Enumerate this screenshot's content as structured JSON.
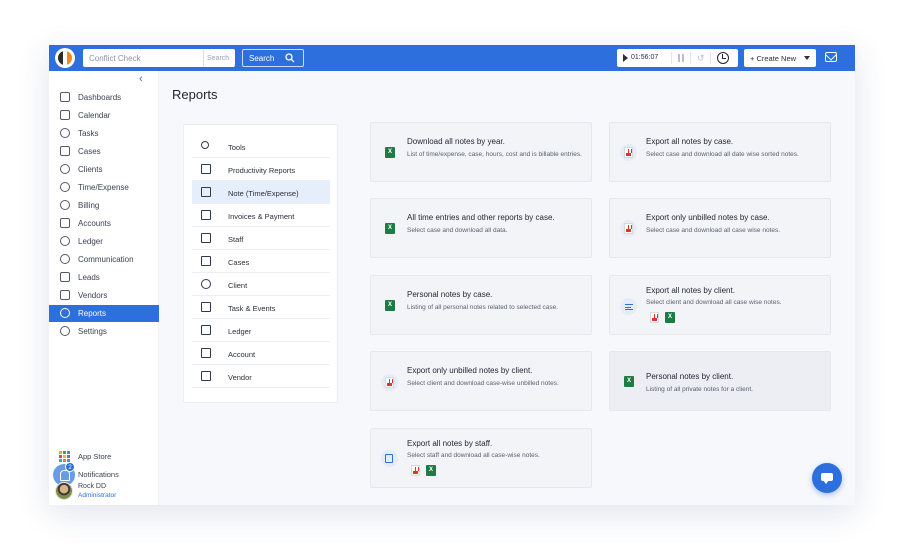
{
  "topbar": {
    "conflict_placeholder": "Conflict Check",
    "conflict_search": "Search",
    "search_label": "Search",
    "timer": "01:56:07",
    "create_new": "+ Create New"
  },
  "sidebar": {
    "items": [
      {
        "label": "Dashboards",
        "icon": "home-icon"
      },
      {
        "label": "Calendar",
        "icon": "calendar-icon"
      },
      {
        "label": "Tasks",
        "icon": "check-circle-icon"
      },
      {
        "label": "Cases",
        "icon": "briefcase-icon"
      },
      {
        "label": "Clients",
        "icon": "users-icon"
      },
      {
        "label": "Time/Expense",
        "icon": "stopwatch-icon"
      },
      {
        "label": "Billing",
        "icon": "dollar-icon"
      },
      {
        "label": "Accounts",
        "icon": "bank-icon"
      },
      {
        "label": "Ledger",
        "icon": "ledger-icon"
      },
      {
        "label": "Communication",
        "icon": "phone-icon"
      },
      {
        "label": "Leads",
        "icon": "leads-icon"
      },
      {
        "label": "Vendors",
        "icon": "vendor-icon"
      },
      {
        "label": "Reports",
        "icon": "pie-chart-icon"
      },
      {
        "label": "Settings",
        "icon": "gear-icon"
      }
    ],
    "active": "Reports",
    "app_store": "App Store",
    "notifications": "Notifications",
    "notif_count": "2",
    "user_name": "Rock DD",
    "user_role": "Administrator"
  },
  "page": {
    "title": "Reports"
  },
  "report_menu": [
    {
      "label": "Tools",
      "icon": "wrench-icon"
    },
    {
      "label": "Productivity Reports",
      "icon": "bar-chart-icon"
    },
    {
      "label": "Note (Time/Expense)",
      "icon": "note-icon"
    },
    {
      "label": "Invoices & Payment",
      "icon": "invoice-icon"
    },
    {
      "label": "Staff",
      "icon": "staff-icon"
    },
    {
      "label": "Cases",
      "icon": "briefcase-icon"
    },
    {
      "label": "Client",
      "icon": "client-icon"
    },
    {
      "label": "Task & Events",
      "icon": "calendar-icon"
    },
    {
      "label": "Ledger",
      "icon": "ledger-icon"
    },
    {
      "label": "Account",
      "icon": "bank-icon"
    },
    {
      "label": "Vendor",
      "icon": "vendor-icon"
    }
  ],
  "report_cards": [
    {
      "title": "Download all notes by year.",
      "desc": "List of time/expense, case, hours, cost and is billable entries.",
      "icon": "excel-icon"
    },
    {
      "title": "Export all notes by case.",
      "desc": "Select case and download all date wise sorted notes.",
      "icon": "pdf-icon"
    },
    {
      "title": "All time entries and other reports by case.",
      "desc": "Select case and download all data.",
      "icon": "excel-icon"
    },
    {
      "title": "Export only unbilled notes by case.",
      "desc": "Select case and download all case wise notes.",
      "icon": "pdf-icon"
    },
    {
      "title": "Personal notes by case.",
      "desc": "Listing of all personal notes related to selected case.",
      "icon": "excel-icon"
    },
    {
      "title": "Export all notes by client.",
      "desc": "Select client and download all case wise notes.",
      "icon": "lines-icon"
    },
    {
      "title": "Export only unbilled notes by client.",
      "desc": "Select client and download case-wise unbilled notes.",
      "icon": "pdf-icon"
    },
    {
      "title": "Personal notes by client.",
      "desc": "Listing of all private notes for a client.",
      "icon": "excel-icon"
    },
    {
      "title": "Export all notes by staff.",
      "desc": "Select staff and download all case-wise notes.",
      "icon": "document-icon"
    }
  ],
  "colors": {
    "accent": "#2d6fdc",
    "excel": "#1f7a45",
    "pdf": "#e0342a"
  }
}
